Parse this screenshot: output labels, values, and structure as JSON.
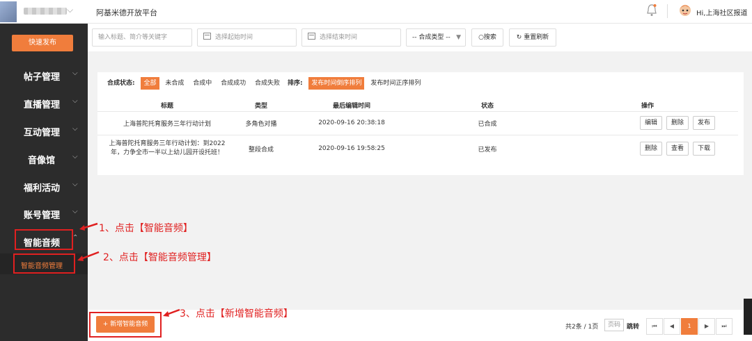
{
  "header": {
    "platform_title": "阿基米德开放平台",
    "greeting": "Hi,上海社区报道"
  },
  "sidebar": {
    "quick_publish": "快速发布",
    "items": [
      {
        "label": "帖子管理"
      },
      {
        "label": "直播管理"
      },
      {
        "label": "互动管理"
      },
      {
        "label": "音像馆"
      },
      {
        "label": "福利活动"
      },
      {
        "label": "账号管理"
      },
      {
        "label": "智能音频"
      }
    ],
    "sub_item": "智能音频管理"
  },
  "filter": {
    "keyword_placeholder": "输入标题、简介等关键字",
    "start_placeholder": "选择起始时间",
    "end_placeholder": "选择结束时间",
    "type_select": "-- 合成类型 --",
    "search_label": "搜索",
    "reset_label": "重置刷新"
  },
  "status_bar": {
    "status_label": "合成状态:",
    "statuses": [
      "全部",
      "未合成",
      "合成中",
      "合成成功",
      "合成失败"
    ],
    "sort_label": "排序:",
    "sorts": [
      "发布时间倒序排列",
      "发布时间正序排列"
    ]
  },
  "table": {
    "headers": [
      "标题",
      "类型",
      "最后编辑时间",
      "状态",
      "操作"
    ],
    "rows": [
      {
        "title": "上海普陀托育服务三年行动计划",
        "type": "多角色对播",
        "time": "2020-09-16 20:38:18",
        "status": "已合成",
        "actions": [
          "编辑",
          "删除",
          "发布"
        ]
      },
      {
        "title_line1": "上海普陀托育服务三年行动计划：到2022",
        "title_line2": "年，力争全市一半以上幼儿园开设托班！",
        "type": "整段合成",
        "time": "2020-09-16 19:58:25",
        "status": "已发布",
        "actions": [
          "删除",
          "查看",
          "下载"
        ]
      }
    ]
  },
  "footer": {
    "new_button": "+ 新增智能音频",
    "pager_info": "共2条 / 1页",
    "page_placeholder": "页码",
    "jump_label": "跳转",
    "current_page": "1"
  },
  "annotations": {
    "step1": "1、点击【智能音频】",
    "step2": "2、点击【智能音频管理】",
    "step3": "3、点击【新增智能音频】"
  },
  "colors": {
    "accent": "#f07d3c",
    "sidebar_bg": "#2c2c2c",
    "annotation_red": "#e02020"
  }
}
